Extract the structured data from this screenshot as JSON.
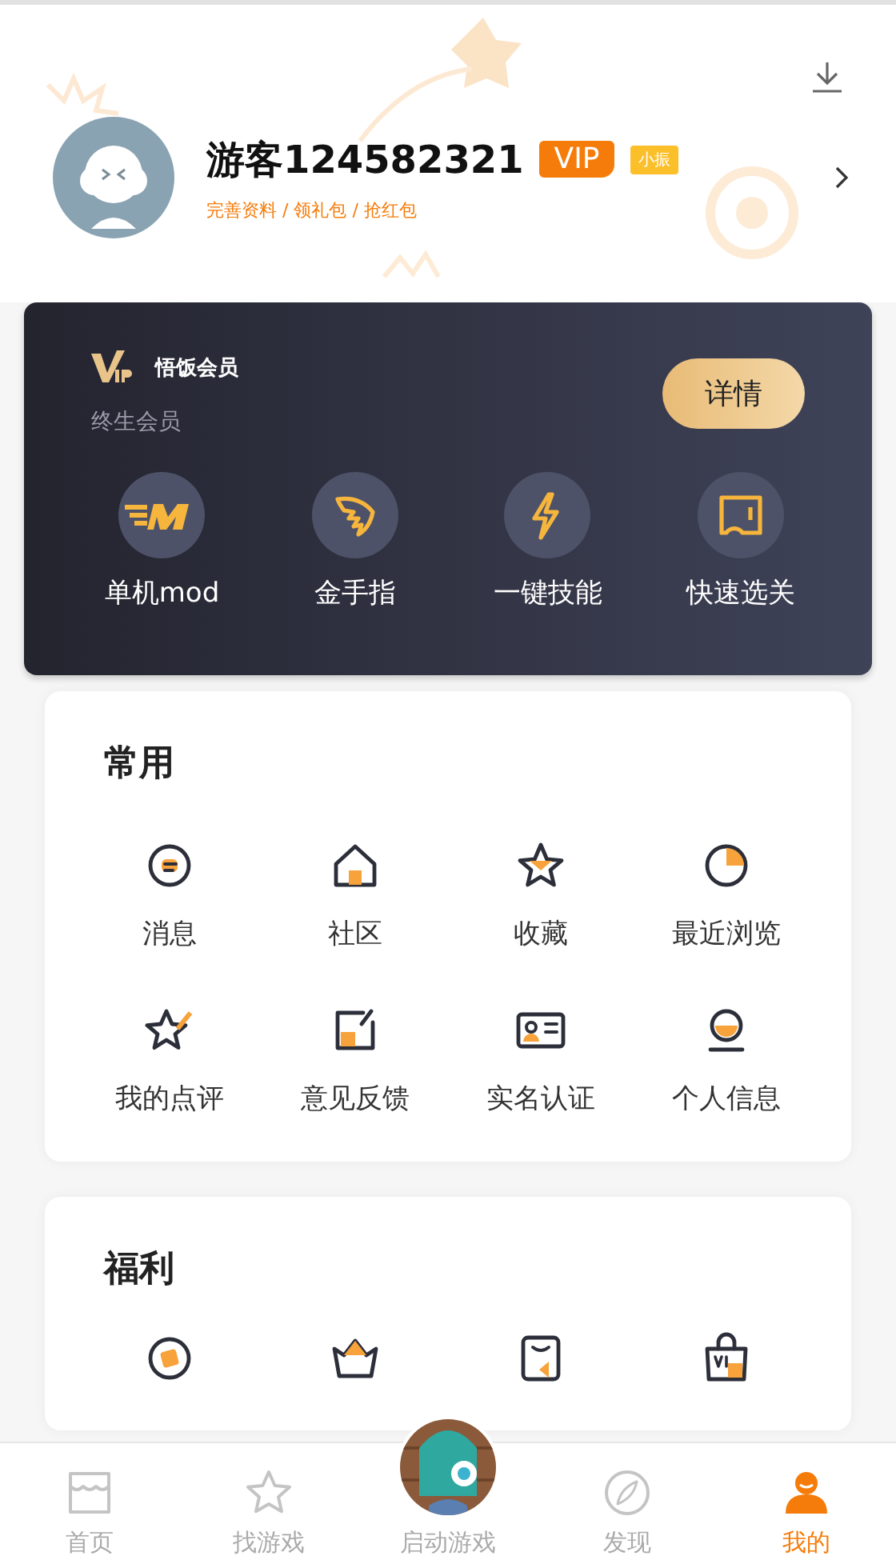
{
  "profile": {
    "name": "游客124582321",
    "vip_badge": "VIP",
    "level_badge": "小振",
    "links": "完善资料 / 领礼包 / 抢红包"
  },
  "vip_card": {
    "logo": "悟饭会员",
    "subtitle": "终生会员",
    "button": "详情",
    "features": [
      {
        "kind": "mod",
        "label": "单机mod"
      },
      {
        "kind": "wing",
        "label": "金手指"
      },
      {
        "kind": "bolt",
        "label": "一键技能"
      },
      {
        "kind": "ticket",
        "label": "快速选关"
      }
    ]
  },
  "common": {
    "title": "常用",
    "items": [
      {
        "kind": "chat",
        "label": "消息"
      },
      {
        "kind": "house",
        "label": "社区"
      },
      {
        "kind": "star",
        "label": "收藏"
      },
      {
        "kind": "pie",
        "label": "最近浏览"
      },
      {
        "kind": "starpen",
        "label": "我的点评"
      },
      {
        "kind": "note",
        "label": "意见反馈"
      },
      {
        "kind": "idcard",
        "label": "实名认证"
      },
      {
        "kind": "person",
        "label": "个人信息"
      }
    ]
  },
  "welfare": {
    "title": "福利",
    "items": [
      {
        "kind": "coin"
      },
      {
        "kind": "basket"
      },
      {
        "kind": "bag"
      },
      {
        "kind": "vipbag"
      }
    ]
  },
  "nav": [
    {
      "kind": "store",
      "label": "首页",
      "selected": false
    },
    {
      "kind": "star",
      "label": "找游戏",
      "selected": false
    },
    {
      "kind": "launch",
      "label": "启动游戏",
      "selected": false
    },
    {
      "kind": "compass",
      "label": "发现",
      "selected": false
    },
    {
      "kind": "user",
      "label": "我的",
      "selected": true
    }
  ]
}
